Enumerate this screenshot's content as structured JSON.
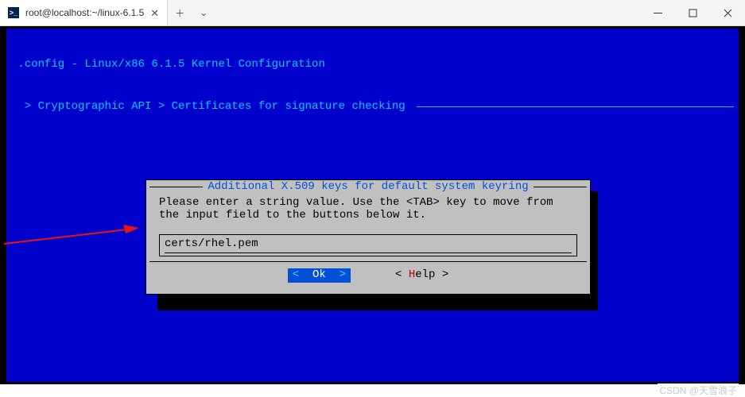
{
  "titlebar": {
    "tab_title": "root@localhost:~/linux-6.1.5"
  },
  "terminal": {
    "line1": " .config - Linux/x86 6.1.5 Kernel Configuration",
    "line2": "  > Cryptographic API > Certificates for signature checking "
  },
  "dialog": {
    "title": " Additional X.509 keys for default system keyring ",
    "prompt": "Please enter a string value. Use the <TAB> key to move from the input field to the buttons below it.",
    "input_value": "certs/rhel.pem",
    "ok_lt": "<  ",
    "ok_label": "Ok",
    "ok_gt": "  >",
    "help_lt": "< ",
    "help_hot": "H",
    "help_rest": "elp >"
  },
  "watermark": "CSDN @天雪浪子"
}
